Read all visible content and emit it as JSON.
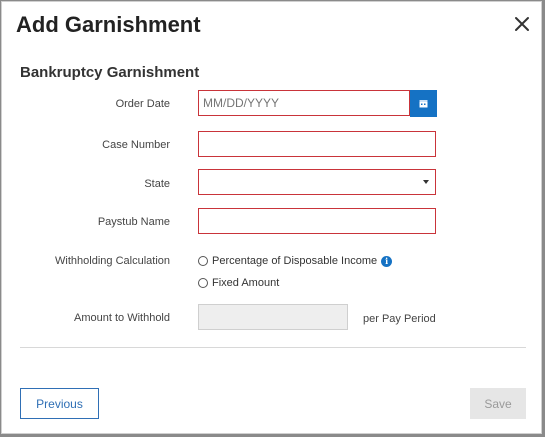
{
  "modal": {
    "title": "Add Garnishment",
    "close_icon": "close-icon"
  },
  "section": {
    "title": "Bankruptcy Garnishment"
  },
  "form": {
    "order_date": {
      "label": "Order Date",
      "placeholder": "MM/DD/YYYY",
      "icon": "calendar-icon"
    },
    "case_number": {
      "label": "Case Number",
      "value": ""
    },
    "state": {
      "label": "State",
      "value": ""
    },
    "paystub_name": {
      "label": "Paystub Name",
      "value": ""
    },
    "withholding_calculation": {
      "label": "Withholding Calculation",
      "options": [
        "Percentage of Disposable Income",
        "Fixed Amount"
      ],
      "info_icon": "info-icon"
    },
    "amount_to_withhold": {
      "label": "Amount to Withhold",
      "value": "",
      "suffix": "per Pay Period"
    }
  },
  "buttons": {
    "previous": "Previous",
    "save": "Save"
  },
  "colors": {
    "accent": "#1572c4",
    "error_border": "#c9343a"
  }
}
